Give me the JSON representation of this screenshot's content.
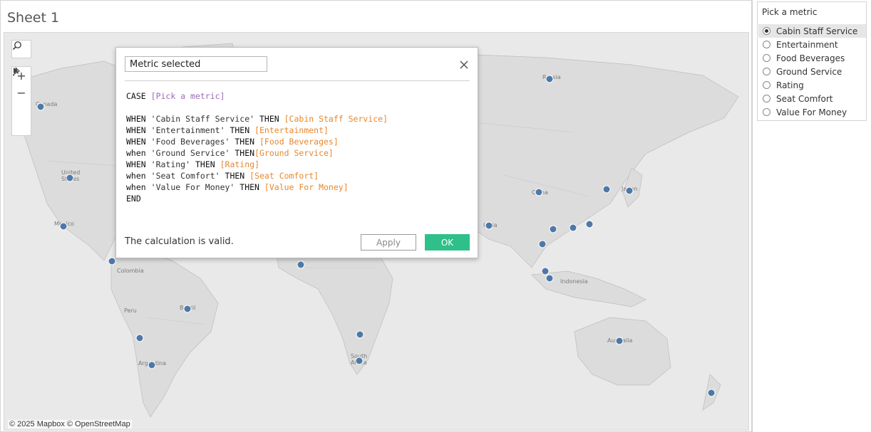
{
  "sheet": {
    "title": "Sheet 1"
  },
  "map": {
    "attribution": "© 2025 Mapbox © OpenStreetMap",
    "labels": {
      "russia": "Russia",
      "canada": "Canada",
      "united_states": "United\nStates",
      "mexico": "Mexico",
      "colombia": "Colombia",
      "peru": "Peru",
      "brazil": "Brazil",
      "argentina": "Argentina",
      "south_africa": "South\nAfrica",
      "china": "China",
      "japan": "Japan",
      "india": "India",
      "indonesia": "Indonesia",
      "australia": "Australia"
    },
    "dot_color": "#4e79a7"
  },
  "panel": {
    "title": "Pick a metric",
    "options": [
      {
        "label": "Cabin Staff Service",
        "selected": true
      },
      {
        "label": "Entertainment",
        "selected": false
      },
      {
        "label": "Food Beverages",
        "selected": false
      },
      {
        "label": "Ground Service",
        "selected": false
      },
      {
        "label": "Rating",
        "selected": false
      },
      {
        "label": "Seat Comfort",
        "selected": false
      },
      {
        "label": "Value For Money",
        "selected": false
      }
    ]
  },
  "dialog": {
    "calc_name": "Metric selected",
    "formula": {
      "line1_kw": "CASE",
      "line1_param": "[Pick a metric]",
      "rows": [
        {
          "when": "WHEN",
          "str": "'Cabin Staff Service'",
          "then": "THEN",
          "field": "[Cabin Staff Service]"
        },
        {
          "when": "WHEN",
          "str": "'Entertainment'",
          "then": "THEN",
          "field": "[Entertainment]"
        },
        {
          "when": "WHEN",
          "str": "'Food Beverages'",
          "then": "THEN",
          "field": "[Food Beverages]"
        },
        {
          "when": "when",
          "str": "'Ground Service'",
          "then": "THEN",
          "field": "[Ground Service]"
        },
        {
          "when": "WHEN",
          "str": "'Rating'",
          "then": "THEN",
          "field": "[Rating]"
        },
        {
          "when": "when",
          "str": "'Seat Comfort'",
          "then": "THEN",
          "field": "[Seat Comfort]"
        },
        {
          "when": "when",
          "str": "'Value For Money'",
          "then": "THEN",
          "field": "[Value For Money]"
        }
      ],
      "end_kw": "END"
    },
    "status": "The calculation is valid.",
    "apply_label": "Apply",
    "ok_label": "OK"
  },
  "colors": {
    "accent_ok": "#2fc08a",
    "param": "#9c6bb8",
    "field": "#e8872b"
  }
}
